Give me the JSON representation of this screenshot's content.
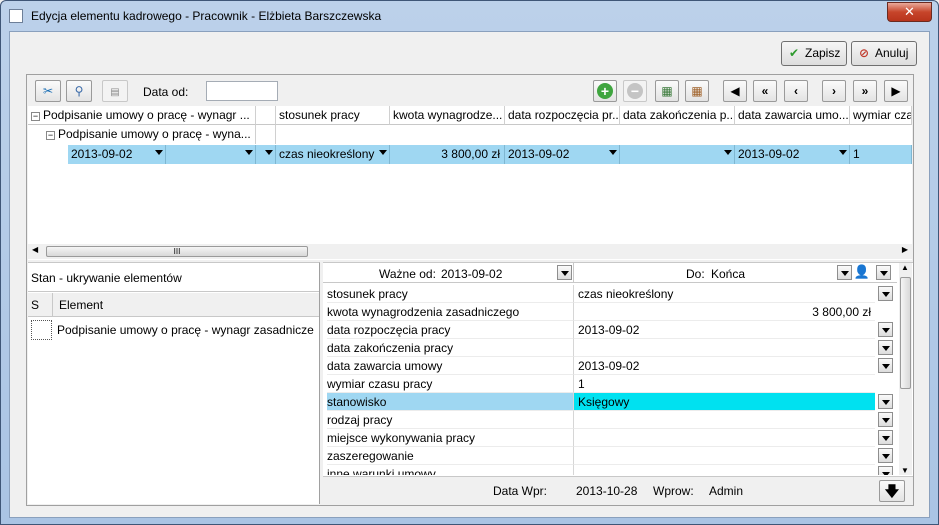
{
  "window": {
    "title": "Edycja elementu kadrowego - Pracownik - Elżbieta Barszczewska",
    "close_glyph": "✕"
  },
  "actions": {
    "save_label": "Zapisz",
    "cancel_label": "Anuluj"
  },
  "toolbar": {
    "date_from_label": "Data od:",
    "date_from_value": ""
  },
  "grid": {
    "tree": [
      "Podpisanie umowy o pracę - wynagr ...",
      "Podpisanie umowy o pracę - wyna..."
    ],
    "columns": [
      "stosunek pracy",
      "kwota wynagrodze...",
      "data rozpoczęcia pr...",
      "data zakończenia p...",
      "data zawarcia umo...",
      "wymiar czas"
    ],
    "selected_row": {
      "date": "2013-09-02",
      "stosunek": "czas nieokreślony",
      "kwota": "3 800,00 zł",
      "rozpoczecie": "2013-09-02",
      "zakonczenie": "",
      "zawarcie": "2013-09-02",
      "wymiar": "1"
    },
    "hscroll_grip": "III"
  },
  "left_panel": {
    "title": "Stan - ukrywanie elementów",
    "col_s": "S",
    "col_element": "Element",
    "items": [
      "Podpisanie umowy o pracę - wynagr zasadnicze"
    ]
  },
  "detail": {
    "valid_from_label": "Ważne od:",
    "valid_from_value": "2013-09-02",
    "to_label": "Do:",
    "to_value": "Końca",
    "rows": [
      {
        "key": "stosunek pracy",
        "value": "czas nieokreślony"
      },
      {
        "key": "kwota wynagrodzenia zasadniczego",
        "value": "3 800,00 zł"
      },
      {
        "key": "data rozpoczęcia pracy",
        "value": "2013-09-02"
      },
      {
        "key": "data zakończenia pracy",
        "value": ""
      },
      {
        "key": "data zawarcia umowy",
        "value": "2013-09-02"
      },
      {
        "key": "wymiar czasu pracy",
        "value": "1"
      },
      {
        "key": "stanowisko",
        "value": "Księgowy"
      },
      {
        "key": "rodzaj pracy",
        "value": ""
      },
      {
        "key": "miejsce wykonywania pracy",
        "value": ""
      },
      {
        "key": "zaszeregowanie",
        "value": ""
      },
      {
        "key": "inne warunki umowy",
        "value": ""
      }
    ]
  },
  "footer": {
    "data_wpr_label": "Data Wpr:",
    "data_wpr_value": "2013-10-28",
    "wprow_label": "Wprow:",
    "wprow_value": "Admin"
  },
  "colors": {
    "selection": "#9fd7f2",
    "highlight": "#00e1f0"
  }
}
